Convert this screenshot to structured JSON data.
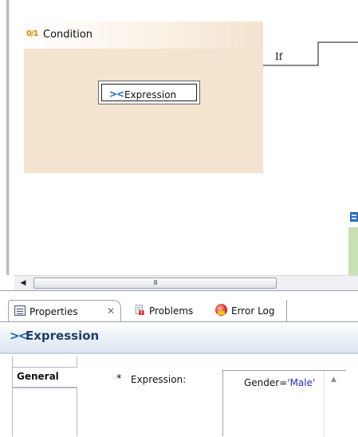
{
  "canvas": {
    "condition": {
      "icon_text": "0/1",
      "title": "Condition"
    },
    "expression_node": {
      "icon_text": "><",
      "label": "Expression"
    },
    "if_label": "If"
  },
  "hscroll": {
    "left_arrow": "◀",
    "grip": "III"
  },
  "panel": {
    "tabs": [
      {
        "label": "Properties",
        "icon": "properties-icon",
        "close": "✕",
        "active": true
      },
      {
        "label": "Problems",
        "icon": "problems-icon",
        "active": false
      },
      {
        "label": "Error Log",
        "icon": "error-log-icon",
        "active": false
      }
    ],
    "section": {
      "icon_text": "><",
      "title": "Expression"
    },
    "side_tabs": [
      {
        "label": "General",
        "active": true
      }
    ],
    "fields": [
      {
        "required_marker": "*",
        "label": "Expression:",
        "value_prefix": "Gender=",
        "value_string": "'Male'"
      }
    ],
    "scroll_up": "▲"
  },
  "colors": {
    "condition_fill": "#f3e3cf",
    "accent_blue": "#1a5fb4",
    "section_title": "#1f3f6b",
    "string_literal": "#2a2ad8"
  }
}
